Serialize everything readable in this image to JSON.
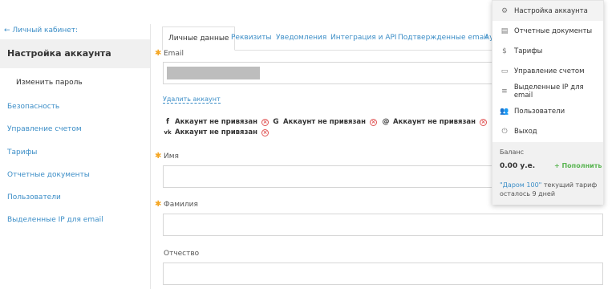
{
  "sidebar": {
    "back_link": "← Личный кабинет:",
    "title": "Настройка аккаунта",
    "sub_item": "Изменить пароль",
    "items": [
      "Безопасность",
      "Управление счетом",
      "Тарифы",
      "Отчетные документы",
      "Пользователи",
      "Выделенные IP для email"
    ]
  },
  "tabs": [
    "Личные данные",
    "Реквизиты",
    "Уведомления",
    "Интеграция и API",
    "Подтвержденные email",
    "Ау"
  ],
  "form": {
    "email_label": "Email",
    "delete_link": "Удалить аккаунт",
    "accounts": [
      {
        "icon": "facebook-icon",
        "glyph": "f",
        "label": "Аккаунт не привязан"
      },
      {
        "icon": "google-icon",
        "glyph": "G",
        "label": "Аккаунт не привязан"
      },
      {
        "icon": "mail-ru-icon",
        "glyph": "@",
        "label": "Аккаунт не привязан"
      },
      {
        "icon": "vk-icon",
        "glyph": "vk",
        "label": "Аккаунт не привязан"
      }
    ],
    "name_label": "Имя",
    "surname_label": "Фамилия",
    "patronymic_label": "Отчество"
  },
  "menu": {
    "items": [
      {
        "icon": "gear-icon",
        "glyph": "⚙",
        "label": "Настройка аккаунта"
      },
      {
        "icon": "document-icon",
        "glyph": "▤",
        "label": "Отчетные документы"
      },
      {
        "icon": "dollar-icon",
        "glyph": "$",
        "label": "Тарифы"
      },
      {
        "icon": "wallet-icon",
        "glyph": "▭",
        "label": "Управление счетом"
      },
      {
        "icon": "database-icon",
        "glyph": "≡",
        "label": "Выделенные IP для email"
      },
      {
        "icon": "users-icon",
        "glyph": "👥",
        "label": "Пользователи"
      },
      {
        "icon": "power-icon",
        "glyph": "⏻",
        "label": "Выход"
      }
    ],
    "balance_label": "Баланс",
    "balance_value": "0.00 у.е.",
    "topup": "+ Пополнить",
    "tariff_name": "\"Даром 100\"",
    "tariff_text": " текущий тариф осталось 9 дней"
  },
  "colors": {
    "link": "#3c8ec7",
    "required": "#f5a623",
    "topup": "#5ab552",
    "error": "#e05555"
  }
}
